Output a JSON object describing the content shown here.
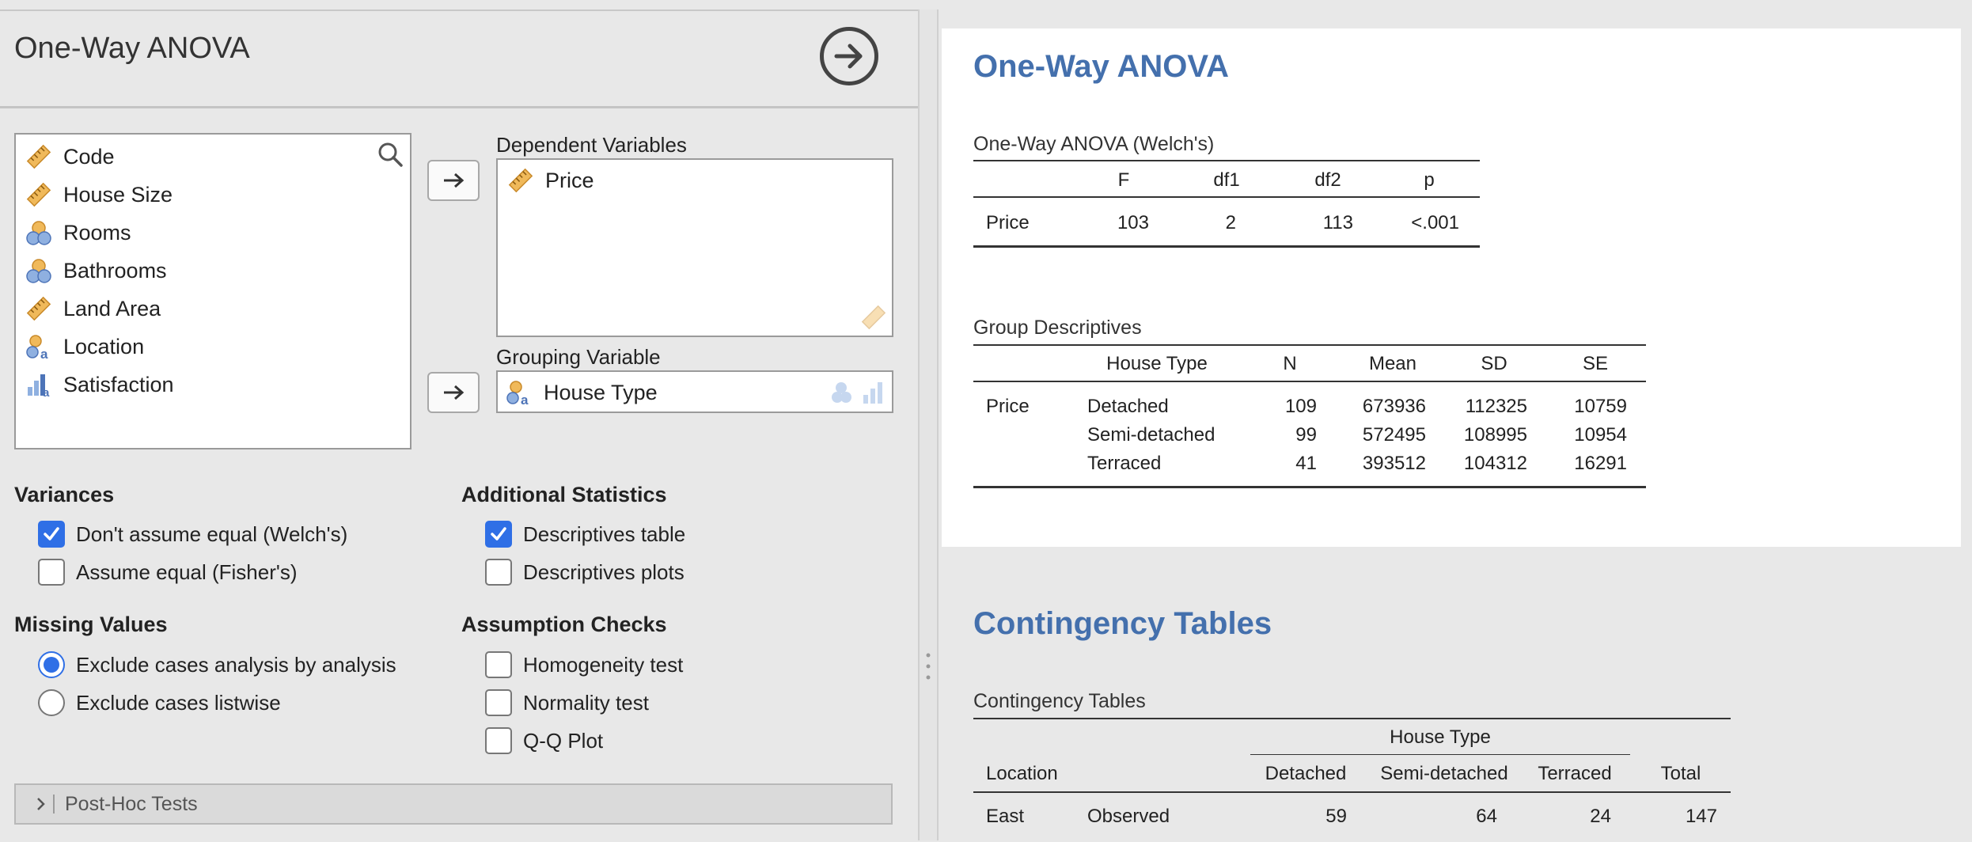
{
  "analysis_panel": {
    "title": "One-Way ANOVA",
    "variables": [
      {
        "name": "Code",
        "icon": "continuous-ruler-icon"
      },
      {
        "name": "House Size",
        "icon": "continuous-ruler-icon"
      },
      {
        "name": "Rooms",
        "icon": "ordinal-circles-icon"
      },
      {
        "name": "Bathrooms",
        "icon": "ordinal-circles-icon"
      },
      {
        "name": "Land Area",
        "icon": "continuous-ruler-icon"
      },
      {
        "name": "Location",
        "icon": "nominal-text-icon"
      },
      {
        "name": "Satisfaction",
        "icon": "nominal-bars-icon"
      }
    ],
    "dependent_label": "Dependent Variables",
    "dependent_vars": [
      "Price"
    ],
    "grouping_label": "Grouping Variable",
    "grouping_var": "House Type",
    "variances": {
      "heading": "Variances",
      "options": [
        {
          "label": "Don't assume equal (Welch's)",
          "checked": true
        },
        {
          "label": "Assume equal (Fisher's)",
          "checked": false
        }
      ]
    },
    "additional": {
      "heading": "Additional Statistics",
      "options": [
        {
          "label": "Descriptives table",
          "checked": true
        },
        {
          "label": "Descriptives plots",
          "checked": false
        }
      ]
    },
    "missing": {
      "heading": "Missing Values",
      "options": [
        {
          "label": "Exclude cases analysis by analysis",
          "selected": true
        },
        {
          "label": "Exclude cases listwise",
          "selected": false
        }
      ]
    },
    "assumptions": {
      "heading": "Assumption Checks",
      "options": [
        {
          "label": "Homogeneity test",
          "checked": false
        },
        {
          "label": "Normality test",
          "checked": false
        },
        {
          "label": "Q-Q Plot",
          "checked": false
        }
      ]
    },
    "posthoc_label": "Post-Hoc Tests"
  },
  "results": {
    "anova_heading": "One-Way ANOVA",
    "welch_table": {
      "title": "One-Way ANOVA (Welch's)",
      "headers": [
        "",
        "F",
        "df1",
        "df2",
        "p"
      ],
      "rows": [
        [
          "Price",
          "103",
          "2",
          "113",
          "<.001"
        ]
      ]
    },
    "desc_table": {
      "title": "Group Descriptives",
      "headers": [
        "",
        "House Type",
        "N",
        "Mean",
        "SD",
        "SE"
      ],
      "rows": [
        [
          "Price",
          "Detached",
          "109",
          "673936",
          "112325",
          "10759"
        ],
        [
          "",
          "Semi-detached",
          "99",
          "572495",
          "108995",
          "10954"
        ],
        [
          "",
          "Terraced",
          "41",
          "393512",
          "104312",
          "16291"
        ]
      ]
    },
    "contingency_heading": "Contingency Tables",
    "contingency_table": {
      "title": "Contingency Tables",
      "group_header": "House Type",
      "headers": [
        "Location",
        "",
        "Detached",
        "Semi-detached",
        "Terraced",
        "Total"
      ],
      "rows": [
        [
          "East",
          "Observed",
          "59",
          "64",
          "24",
          "147"
        ]
      ]
    }
  },
  "colors": {
    "accent": "#2f6fe6",
    "heading_blue": "#4470ad",
    "ruler_orange": "#e8a840"
  }
}
